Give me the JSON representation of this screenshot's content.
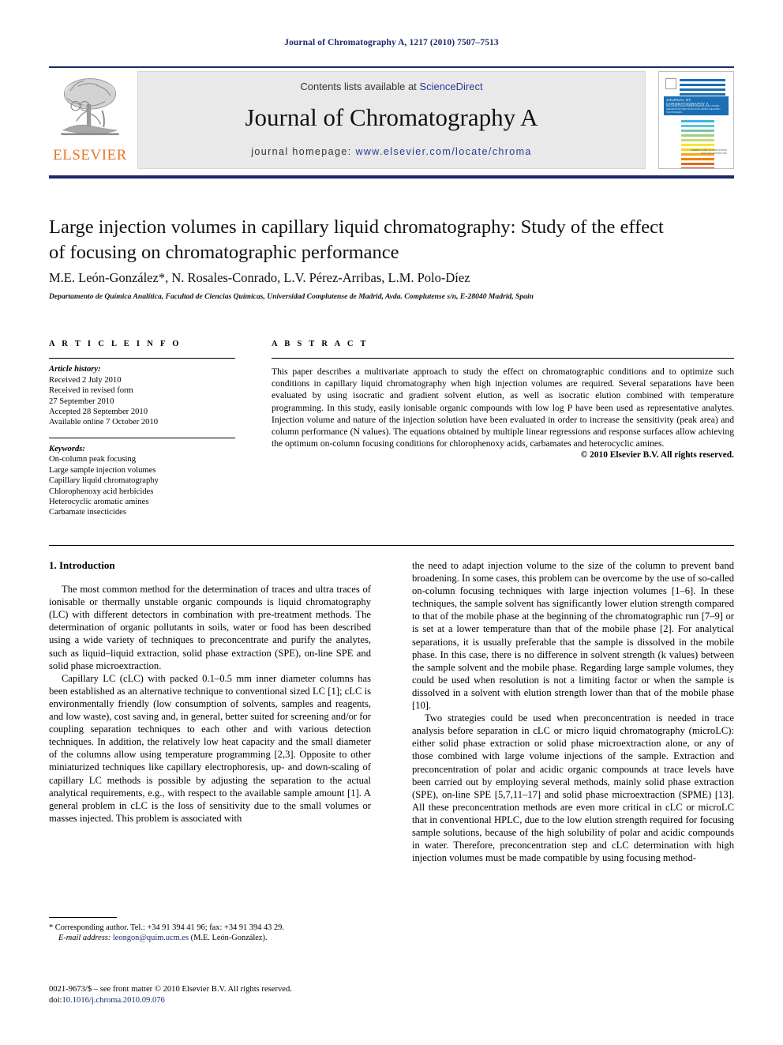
{
  "running_head": "Journal of Chromatography A, 1217 (2010) 7507–7513",
  "masthead": {
    "publisher_name": "ELSEVIER",
    "contents_prefix": "Contents lists available at ",
    "contents_link": "ScienceDirect",
    "journal_title": "Journal of Chromatography A",
    "homepage_prefix": "journal homepage: ",
    "homepage_url": "www.elsevier.com/locate/chroma",
    "cover": {
      "title": "JOURNAL OF CHROMATOGRAPHY A",
      "subtitle": "INCLUDING ELECTROPHORESIS AND OTHER SEPARATION METHODS INCLUDING RELATED TECHNIQUES",
      "footer": "Available online at ScienceDirect www.sciencedirect.com",
      "band_color": "#1a6fb5",
      "bar_colors": [
        "#1a6fb5",
        "#1a6fb5",
        "#1a6fb5",
        "#1a6fb5",
        "#3fb6e0",
        "#5fc4d8",
        "#79c7a8",
        "#9ccf8a",
        "#c8d96a",
        "#f2e23a",
        "#f7d11e",
        "#f9bf16",
        "#f6a413",
        "#f08a12",
        "#e8701a",
        "#df5a20",
        "#d64326"
      ]
    },
    "rule_color": "#1b2a6b"
  },
  "article": {
    "title": "Large injection volumes in capillary liquid chromatography: Study of the effect of focusing on chromatographic performance",
    "authors": "M.E. León-González*, N. Rosales-Conrado, L.V. Pérez-Arribas, L.M. Polo-Díez",
    "affiliation": "Departamento de Química Analítica, Facultad de Ciencias Químicas, Universidad Complutense de Madrid, Avda. Complutense s/n, E-28040 Madrid, Spain"
  },
  "article_info": {
    "heading": "A R T I C L E   I N F O",
    "history_label": "Article history:",
    "history_lines": [
      "Received 2 July 2010",
      "Received in revised form",
      "27 September 2010",
      "Accepted 28 September 2010",
      "Available online 7 October 2010"
    ],
    "keywords_label": "Keywords:",
    "keywords": [
      "On-column peak focusing",
      "Large sample injection volumes",
      "Capillary liquid chromatography",
      "Chlorophenoxy acid herbicides",
      "Heterocyclic aromatic amines",
      "Carbamate insecticides"
    ]
  },
  "abstract": {
    "heading": "A B S T R A C T",
    "text": "This paper describes a multivariate approach to study the effect on chromatographic conditions and to optimize such conditions in capillary liquid chromatography when high injection volumes are required. Several separations have been evaluated by using isocratic and gradient solvent elution, as well as isocratic elution combined with temperature programming. In this study, easily ionisable organic compounds with low log P have been used as representative analytes. Injection volume and nature of the injection solution have been evaluated in order to increase the sensitivity (peak area) and column performance (N values). The equations obtained by multiple linear regressions and response surfaces allow achieving the optimum on-column focusing conditions for chlorophenoxy acids, carbamates and heterocyclic amines.",
    "copyright": "© 2010 Elsevier B.V. All rights reserved."
  },
  "body": {
    "section_number_title": "1.  Introduction",
    "left_paragraphs": [
      "The most common method for the determination of traces and ultra traces of ionisable or thermally unstable organic compounds is liquid chromatography (LC) with different detectors in combination with pre-treatment methods. The determination of organic pollutants in soils, water or food has been described using a wide variety of techniques to preconcentrate and purify the analytes, such as liquid–liquid extraction, solid phase extraction (SPE), on-line SPE and solid phase microextraction.",
      "Capillary LC (cLC) with packed 0.1–0.5 mm inner diameter columns has been established as an alternative technique to conventional sized LC [1]; cLC is environmentally friendly (low consumption of solvents, samples and reagents, and low waste), cost saving and, in general, better suited for screening and/or for coupling separation techniques to each other and with various detection techniques. In addition, the relatively low heat capacity and the small diameter of the columns allow using temperature programming [2,3]. Opposite to other miniaturized techniques like capillary electrophoresis, up- and down-scaling of capillary LC methods is possible by adjusting the separation to the actual analytical requirements, e.g., with respect to the available sample amount [1]. A general problem in cLC is the loss of sensitivity due to the small volumes or masses injected. This problem is associated with"
    ],
    "right_paragraphs": [
      "the need to adapt injection volume to the size of the column to prevent band broadening. In some cases, this problem can be overcome by the use of so-called on-column focusing techniques with large injection volumes [1–6]. In these techniques, the sample solvent has significantly lower elution strength compared to that of the mobile phase at the beginning of the chromatographic run [7–9] or is set at a lower temperature than that of the mobile phase [2]. For analytical separations, it is usually preferable that the sample is dissolved in the mobile phase. In this case, there is no difference in solvent strength (k values) between the sample solvent and the mobile phase. Regarding large sample volumes, they could be used when resolution is not a limiting factor or when the sample is dissolved in a solvent with elution strength lower than that of the mobile phase [10].",
      "Two strategies could be used when preconcentration is needed in trace analysis before separation in cLC or micro liquid chromatography (microLC): either solid phase extraction or solid phase microextraction alone, or any of those combined with large volume injections of the sample. Extraction and preconcentration of polar and acidic organic compounds at trace levels have been carried out by employing several methods, mainly solid phase extraction (SPE), on-line SPE [5,7,11–17] and solid phase microextraction (SPME) [13]. All these preconcentration methods are even more critical in cLC or microLC that in conventional HPLC, due to the low elution strength required for focusing sample solutions, because of the high solubility of polar and acidic compounds in water. Therefore, preconcentration step and cLC determination with high injection volumes must be made compatible by using focusing method-"
    ]
  },
  "footnotes": {
    "corresponding": "* Corresponding author. Tel.: +34 91 394 41 96; fax: +34 91 394 43 29.",
    "email_label": "E-mail address:",
    "email": "leongon@quim.ucm.es",
    "email_owner": "(M.E. León-González).",
    "imprint": "0021-9673/$ – see front matter © 2010 Elsevier B.V. All rights reserved.",
    "doi_label": "doi:",
    "doi": "10.1016/j.chroma.2010.09.076"
  }
}
